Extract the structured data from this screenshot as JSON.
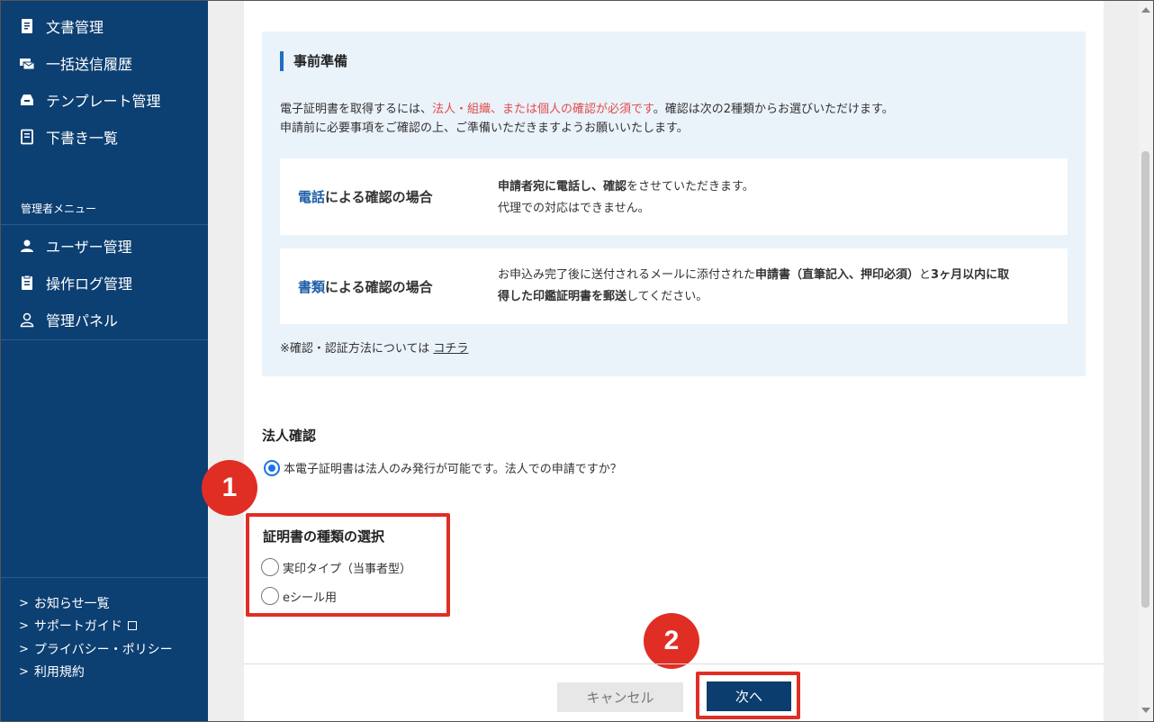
{
  "sidebar": {
    "top_items": [
      {
        "label": "文書管理",
        "icon": "document-icon"
      },
      {
        "label": "一括送信履歴",
        "icon": "batch-send-icon"
      },
      {
        "label": "テンプレート管理",
        "icon": "template-icon"
      },
      {
        "label": "下書き一覧",
        "icon": "draft-icon"
      }
    ],
    "admin_heading": "管理者メニュー",
    "admin_items": [
      {
        "label": "ユーザー管理",
        "icon": "user-icon"
      },
      {
        "label": "操作ログ管理",
        "icon": "log-icon"
      },
      {
        "label": "管理パネル",
        "icon": "admin-panel-icon"
      }
    ],
    "footer_links": [
      {
        "label": "お知らせ一覧"
      },
      {
        "label": "サポートガイド"
      },
      {
        "label": "プライバシー・ポリシー"
      },
      {
        "label": "利用規約"
      }
    ]
  },
  "prep": {
    "title": "事前準備",
    "line1_pre": "電子証明書を取得するには、",
    "line1_red": "法人・組織、または個人の確認が必須です",
    "line1_post": "。確認は次の2種類からお選びいただけます。",
    "line2": "申請前に必要事項をご確認の上、ご準備いただきますようお願いいたします。",
    "phone": {
      "title_blue": "電話",
      "title_rest": "による確認の場合",
      "desc1_b1": "申請者宛に電話し、確認",
      "desc1_t1": "をさせていただきます。",
      "desc2": "代理での対応はできません。"
    },
    "docs": {
      "title_blue": "書類",
      "title_rest": "による確認の場合",
      "desc1_t1": "お申込み完了後に送付されるメールに添付された",
      "desc1_b1": "申請書（直筆記入、押印必須）",
      "desc1_t2": "と",
      "desc1_b2": "3ヶ月以内に取",
      "desc2_b": "得した印鑑証明書を郵送",
      "desc2_t": "してください。"
    },
    "note_text": "※確認・認証方法については",
    "note_link": "コチラ"
  },
  "corp": {
    "heading": "法人確認",
    "option": "本電子証明書は法人のみ発行が可能です。法人での申請ですか？"
  },
  "cert": {
    "heading": "証明書の種類の選択",
    "options": [
      "実印タイプ（当事者型）",
      "eシール用"
    ]
  },
  "steps": [
    "1",
    "2"
  ],
  "buttons": {
    "cancel": "キャンセル",
    "next": "次へ"
  },
  "colors": {
    "sidebar": "#0c3f72",
    "accent": "#1f6fc0",
    "highlight": "#e02e24",
    "primary_button": "#0b3d6e"
  }
}
